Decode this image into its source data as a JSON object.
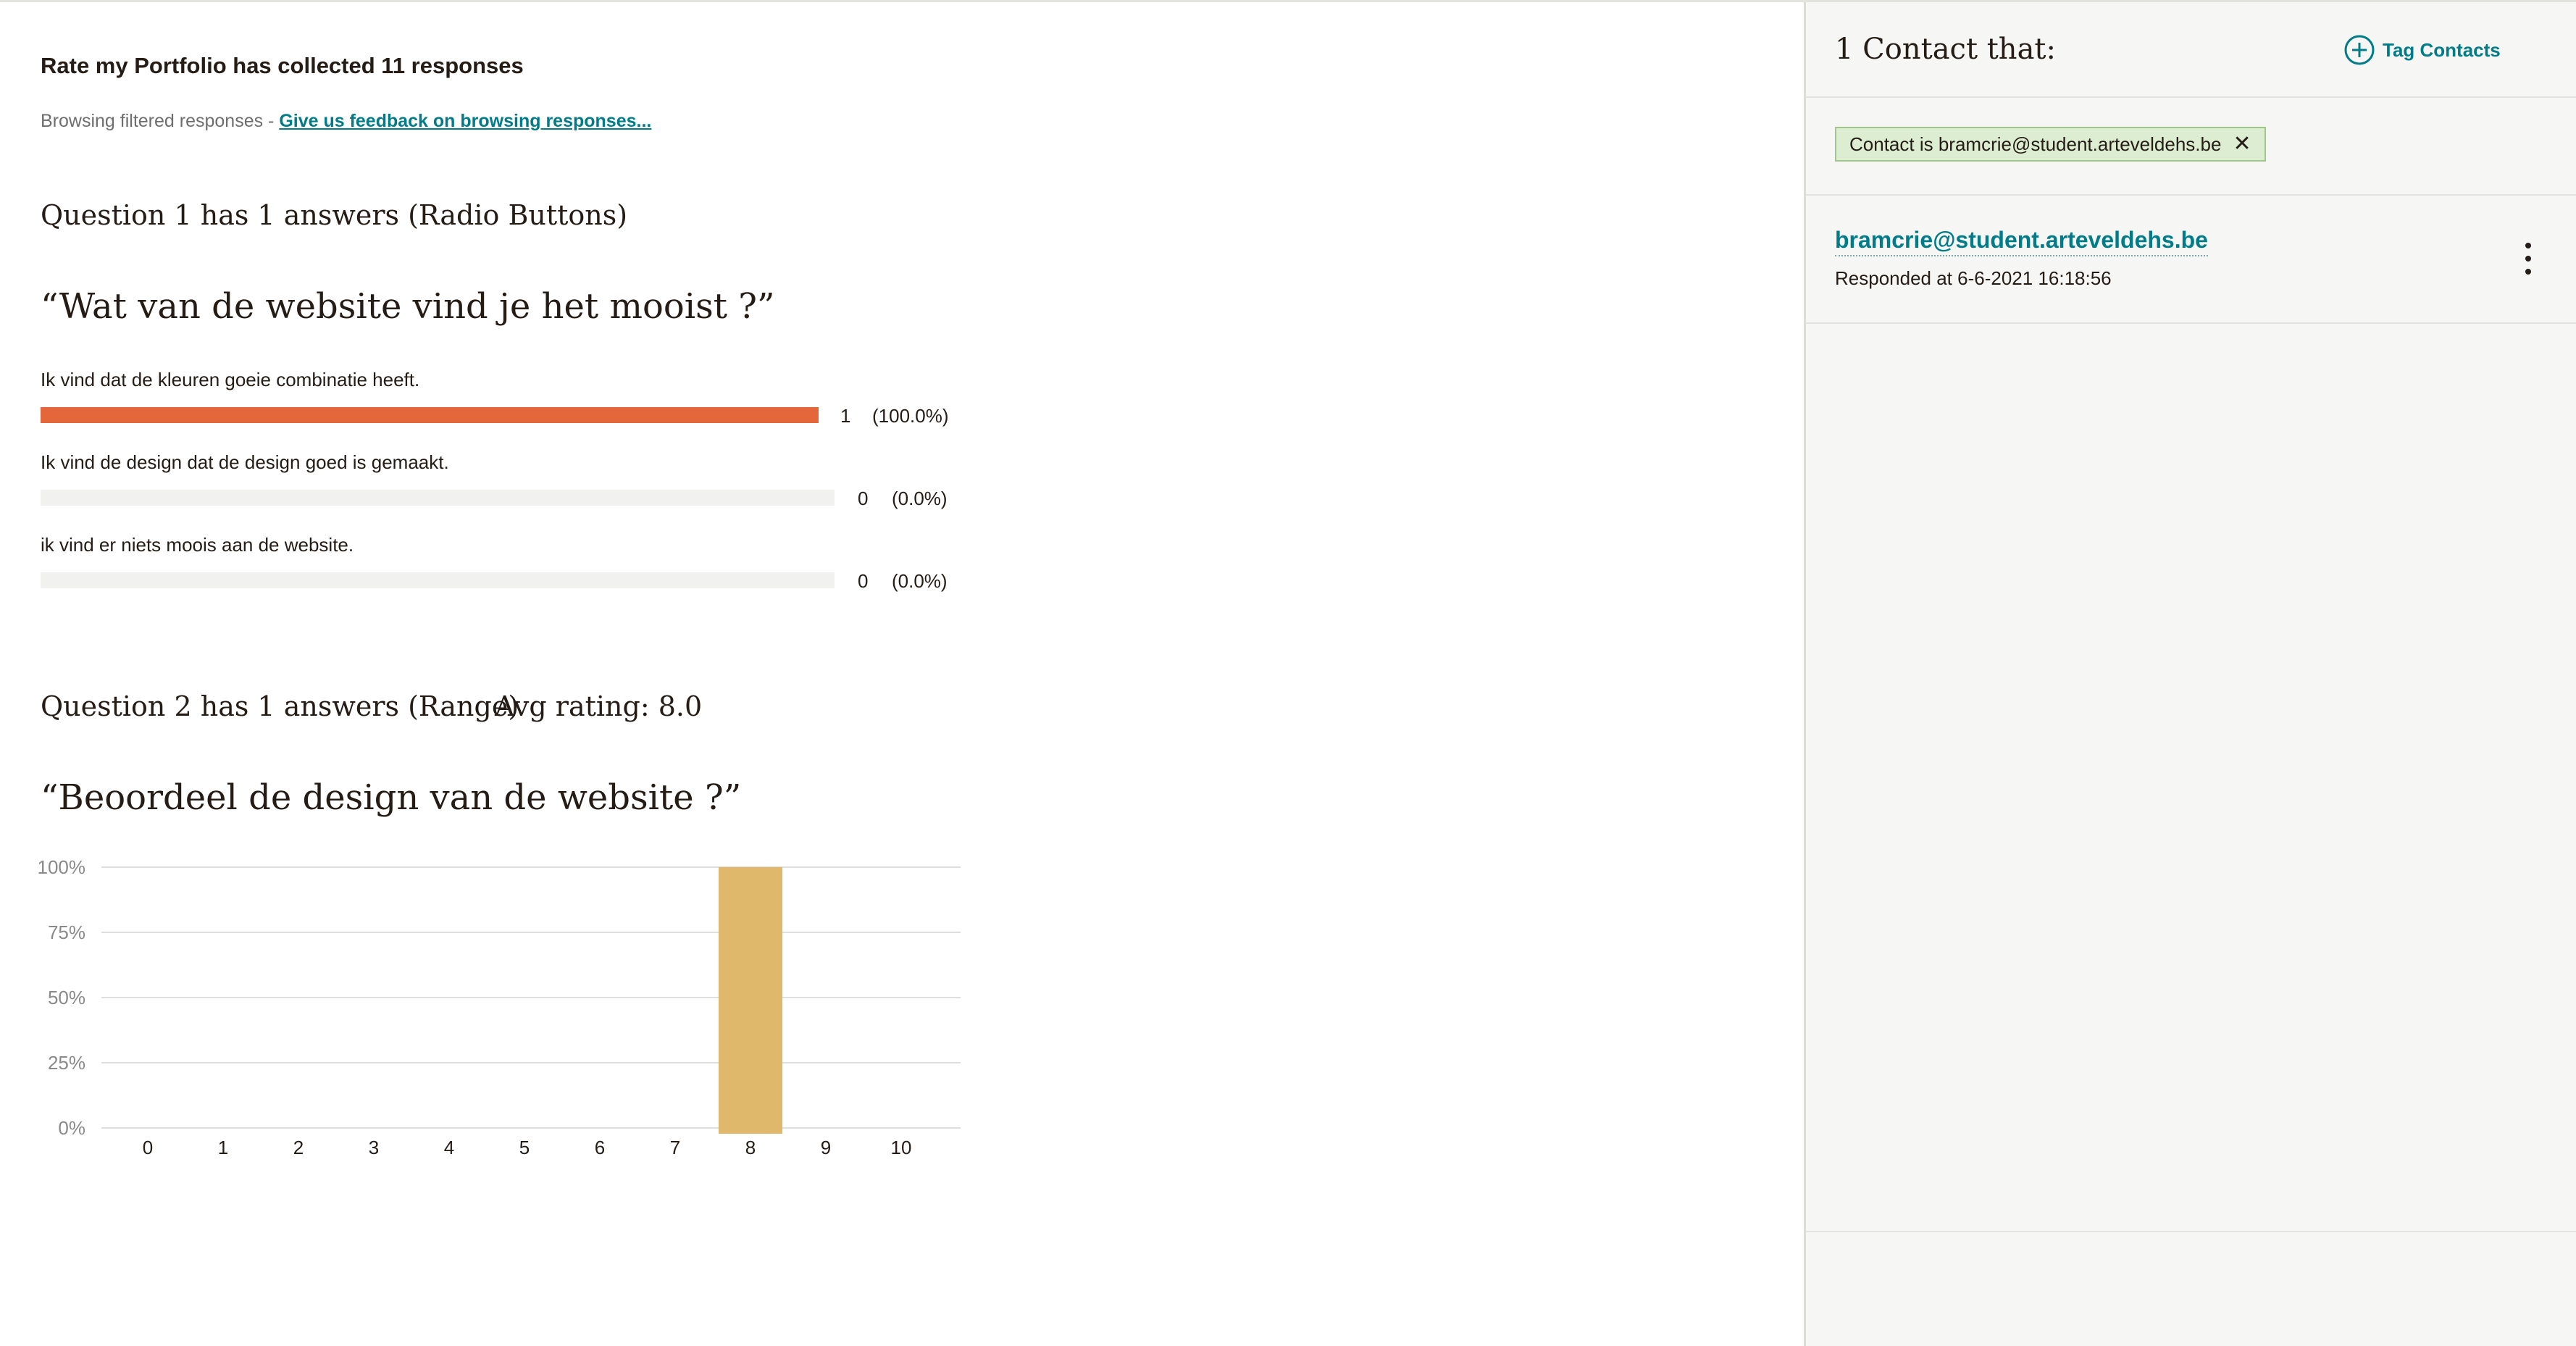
{
  "summary": {
    "title": "Rate my Portfolio has collected 11 responses",
    "browsing_prefix": "Browsing filtered responses - ",
    "feedback_link": "Give us feedback on browsing responses..."
  },
  "question1": {
    "header": "Question 1 has 1 answers (Radio Buttons)",
    "title": "“Wat van de website vind je het mooist ?”",
    "options": [
      {
        "label": "Ik vind dat de kleuren goeie combinatie heeft.",
        "count": "1",
        "percent": "(100.0%)",
        "fraction": 1.0
      },
      {
        "label": "Ik vind de design dat de design goed is gemaakt.",
        "count": "0",
        "percent": "(0.0%)",
        "fraction": 0.0
      },
      {
        "label": "ik vind er niets moois aan de website.",
        "count": "0",
        "percent": "(0.0%)",
        "fraction": 0.0
      }
    ]
  },
  "question2": {
    "header": "Question 2 has 1 answers (Range)",
    "avg": "Avg rating: 8.0",
    "title": "“Beoordeel de design van de website ?”"
  },
  "chart_data": {
    "type": "bar",
    "categories": [
      "0",
      "1",
      "2",
      "3",
      "4",
      "5",
      "6",
      "7",
      "8",
      "9",
      "10"
    ],
    "values": [
      0,
      0,
      0,
      0,
      0,
      0,
      0,
      0,
      100,
      0,
      0
    ],
    "ylim": [
      0,
      100
    ],
    "yticks": [
      "0%",
      "25%",
      "50%",
      "75%",
      "100%"
    ],
    "ytick_values": [
      0,
      25,
      50,
      75,
      100
    ],
    "bar_color": "#e0b86b",
    "grid": true,
    "title": "",
    "xlabel": "",
    "ylabel": ""
  },
  "sidebar": {
    "heading": "1 Contact that:",
    "tag_button": "Tag Contacts",
    "filter_chip": "Contact is bramcrie@student.arteveldehs.be",
    "contact_email": "bramcrie@student.arteveldehs.be",
    "responded": "Responded at 6-6-2021 16:18:56"
  },
  "colors": {
    "accent": "#007c89",
    "bar_fill": "#e3673a",
    "chip_bg": "#dcedd2",
    "range_bar": "#e0b86b"
  }
}
